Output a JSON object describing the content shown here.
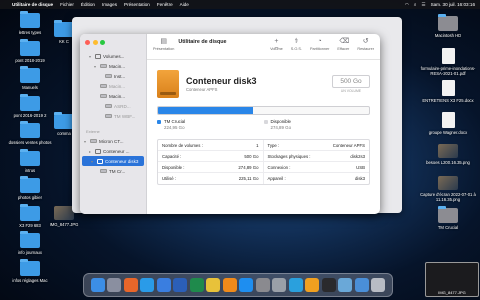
{
  "menubar": {
    "app": "Utilitaire de disque",
    "items": [
      "Fichier",
      "Édition",
      "Images",
      "Présentation",
      "Fenêtre",
      "Aide"
    ],
    "clock": "Sam. 30 juil. 16:03:16"
  },
  "desktop_left": [
    {
      "label": "lettres types",
      "kind": "folder"
    },
    {
      "label": "pont 2018-2019",
      "kind": "folder"
    },
    {
      "label": "Manuels",
      "kind": "folder"
    },
    {
      "label": "pont 2016-2019 2",
      "kind": "folder"
    },
    {
      "label": "dossiers ventes photos",
      "kind": "folder"
    },
    {
      "label": "intrus",
      "kind": "folder"
    },
    {
      "label": "photos gibier",
      "kind": "folder"
    },
    {
      "label": "X3 F29 683",
      "kind": "folder"
    },
    {
      "label": "info journaux",
      "kind": "folder"
    },
    {
      "label": "infos réglages Mac",
      "kind": "folder"
    }
  ],
  "desktop_mid": [
    {
      "label": "KK C",
      "kind": "folder"
    },
    {
      "label": "comma",
      "kind": "folder"
    },
    {
      "label": "IMG_8477.JPG",
      "kind": "image"
    }
  ],
  "desktop_right": [
    {
      "label": "Macintosh HD",
      "kind": "disk"
    },
    {
      "label": "formulaire-prime-inondations-RESA-2021-01.pdf",
      "kind": "doc"
    },
    {
      "label": "ENTRETIENS X3 F25.docx",
      "kind": "doc"
    },
    {
      "label": "groupe Wagner.docx",
      "kind": "doc"
    },
    {
      "label": "besoes L200.16.35.png",
      "kind": "image"
    },
    {
      "label": "Capture d'écran 2022-07-01 à 11.16.35.png",
      "kind": "image"
    },
    {
      "label": "TM Crucial",
      "kind": "disk"
    }
  ],
  "sidebar": {
    "items": [
      {
        "label": "Volumes...",
        "level": 1,
        "kind": "layer",
        "chev": "v",
        "dim": false
      },
      {
        "label": "Macin...",
        "level": 2,
        "kind": "disk",
        "chev": "v",
        "dim": false
      },
      {
        "label": "Inst...",
        "level": 3,
        "kind": "disk",
        "chev": "",
        "dim": false
      },
      {
        "label": "Macin...",
        "level": 2,
        "kind": "disk",
        "chev": "",
        "dim": true
      },
      {
        "label": "Macin...",
        "level": 2,
        "kind": "disk",
        "chev": "",
        "dim": false
      },
      {
        "label": "ASRD...",
        "level": 3,
        "kind": "disk",
        "chev": "",
        "dim": true
      },
      {
        "label": "TM WBF...",
        "level": 3,
        "kind": "disk",
        "chev": "",
        "dim": true
      }
    ],
    "external_header": "Externe",
    "external": [
      {
        "label": "Micron CT...",
        "level": 0,
        "kind": "disk",
        "chev": "v",
        "selected": false
      },
      {
        "label": "Conteneur ...",
        "level": 1,
        "kind": "layer",
        "chev": ">",
        "selected": false
      },
      {
        "label": "Conteneur disk3",
        "level": 1,
        "kind": "layer",
        "chev": "v",
        "selected": true
      },
      {
        "label": "TM Cr...",
        "level": 2,
        "kind": "disk",
        "chev": "",
        "selected": false
      }
    ]
  },
  "toolbar": {
    "view_label": "Présentation",
    "title": "Utilitaire de disque",
    "buttons": [
      {
        "glyph": "+  −",
        "label": "Volume"
      },
      {
        "glyph": "⚕",
        "label": "S.O.S."
      },
      {
        "glyph": "◔",
        "label": "Partitionner"
      },
      {
        "glyph": "⌫",
        "label": "Effacer"
      },
      {
        "glyph": "↺",
        "label": "Restaurer"
      }
    ]
  },
  "container": {
    "name": "Conteneur disk3",
    "subtitle": "Conteneur APFS",
    "size": "500 Go",
    "size_caption": "UN VOLUME",
    "used_fraction": 0.45,
    "colors": {
      "used": "#2a86e8",
      "free": "#e6e6ea"
    },
    "legend": [
      {
        "name": "TM Crucial",
        "size": "224,95 Go",
        "color": "#2a86e8"
      },
      {
        "name": "Disponible",
        "size": "274,89 Go",
        "color": "#d8d8dc"
      }
    ],
    "info": [
      [
        {
          "k": "Nombre de volumes :",
          "v": "1"
        },
        {
          "k": "Type :",
          "v": "Conteneur APFS"
        }
      ],
      [
        {
          "k": "Capacité :",
          "v": "500 Go"
        },
        {
          "k": "Stockages physiques :",
          "v": "disk2s3"
        }
      ],
      [
        {
          "k": "Disponible :",
          "v": "274,89 Go"
        },
        {
          "k": "Connexion :",
          "v": "USB"
        }
      ],
      [
        {
          "k": "Utilisé :",
          "v": "225,11 Go"
        },
        {
          "k": "Appareil :",
          "v": "disk3"
        }
      ]
    ]
  },
  "dock": {
    "apps": [
      {
        "name": "finder",
        "color": "#3c8ee6"
      },
      {
        "name": "launchpad",
        "color": "#8a8fa0"
      },
      {
        "name": "firefox",
        "color": "#e8662a"
      },
      {
        "name": "safari",
        "color": "#2a9be8"
      },
      {
        "name": "mail",
        "color": "#3a7ee0"
      },
      {
        "name": "word",
        "color": "#2b5fb8"
      },
      {
        "name": "excel",
        "color": "#1f8a4c"
      },
      {
        "name": "photos",
        "color": "#e8c23a"
      },
      {
        "name": "vlc",
        "color": "#f08a1a"
      },
      {
        "name": "app-store",
        "color": "#1e8ef0"
      },
      {
        "name": "preferences",
        "color": "#8a8a8f"
      },
      {
        "name": "disk-utility",
        "color": "#9aa0a8"
      },
      {
        "name": "telegram",
        "color": "#2aa0dd"
      },
      {
        "name": "pages",
        "color": "#f0a020"
      },
      {
        "name": "terminal",
        "color": "#2a2a2d"
      },
      {
        "name": "preview",
        "color": "#6aa8d8"
      },
      {
        "name": "downloads",
        "color": "#4a8fd8"
      },
      {
        "name": "trash",
        "color": "#b8bcc4"
      }
    ]
  },
  "screenshot_thumb": {
    "label": "IMG_8477.JPG"
  }
}
